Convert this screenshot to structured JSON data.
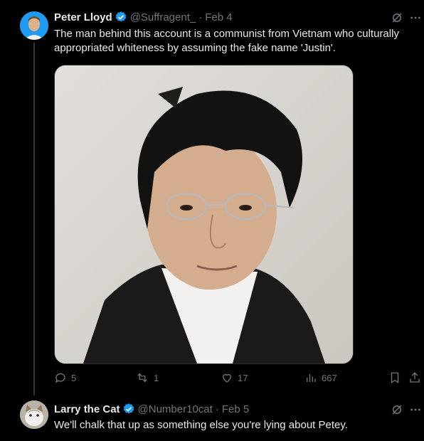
{
  "tweet1": {
    "name": "Peter Lloyd",
    "handle": "@Suffragent_",
    "dot": "·",
    "date": "Feb 4",
    "text": "The man behind this account is a communist from Vietnam who culturally appropriated whiteness by assuming the fake name 'Justin'.",
    "stats": {
      "replies": "5",
      "reposts": "1",
      "likes": "17",
      "views": "667"
    }
  },
  "tweet2": {
    "name": "Larry the Cat",
    "handle": "@Number10cat",
    "dot": "·",
    "date": "Feb 5",
    "text": "We'll chalk that up as something else you're lying about Petey."
  },
  "colors": {
    "verified": "#1d9bf0",
    "muted": "#71767b",
    "text": "#e7e9ea",
    "background": "#000000"
  },
  "icons": [
    "grok-icon",
    "more-icon",
    "reply-icon",
    "repost-icon",
    "like-icon",
    "views-icon",
    "bookmark-icon",
    "share-icon",
    "verified-badge-icon"
  ]
}
